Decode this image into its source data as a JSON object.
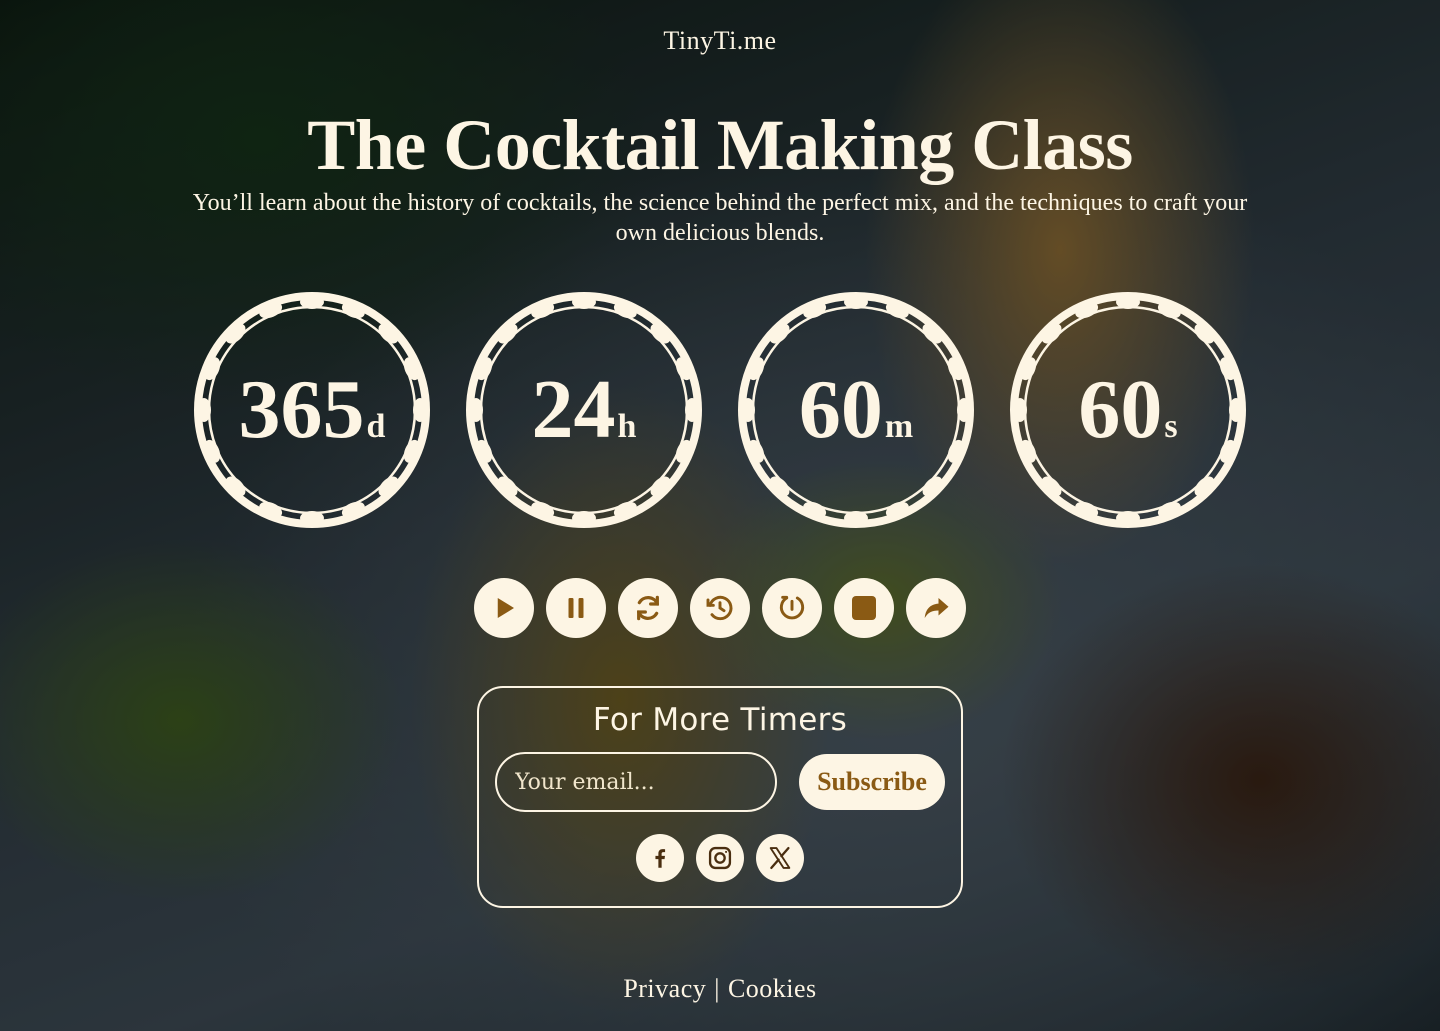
{
  "brand": "TinyTi.me",
  "title": "The Cocktail Making Class",
  "subtitle": "You’ll learn about the history of cocktails, the science behind the perfect mix, and the techniques to craft your own delicious blends.",
  "timers": [
    {
      "value": "365",
      "unit": "d"
    },
    {
      "value": "24",
      "unit": "h"
    },
    {
      "value": "60",
      "unit": "m"
    },
    {
      "value": "60",
      "unit": "s"
    }
  ],
  "controls": [
    {
      "icon": "play-icon"
    },
    {
      "icon": "pause-icon"
    },
    {
      "icon": "refresh-icon"
    },
    {
      "icon": "history-icon"
    },
    {
      "icon": "timer-restart-icon"
    },
    {
      "icon": "stop-icon"
    },
    {
      "icon": "share-icon"
    }
  ],
  "subscribe": {
    "title": "For More Timers",
    "placeholder": "Your email...",
    "button": "Subscribe"
  },
  "socials": [
    {
      "icon": "facebook-icon"
    },
    {
      "icon": "instagram-icon"
    },
    {
      "icon": "x-icon"
    }
  ],
  "footer": {
    "privacy": "Privacy",
    "separator": "|",
    "cookies": "Cookies"
  },
  "colors": {
    "cream": "#fdf5e4",
    "accent": "#8a5a14"
  }
}
